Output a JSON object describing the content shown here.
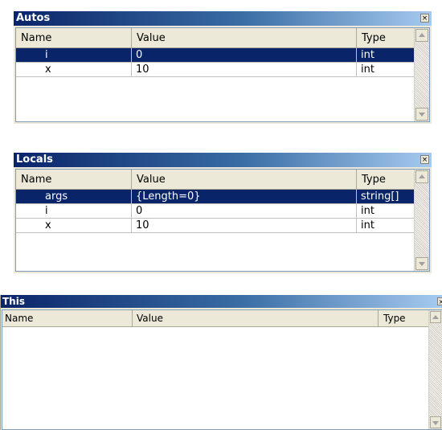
{
  "autos": {
    "title": "Autos",
    "close_glyph": "×",
    "columns": [
      "Name",
      "Value",
      "Type"
    ],
    "rows": [
      {
        "name": "i",
        "value": "0",
        "type": "int",
        "selected": true
      },
      {
        "name": "x",
        "value": "10",
        "type": "int",
        "selected": false
      }
    ]
  },
  "locals": {
    "title": "Locals",
    "close_glyph": "×",
    "columns": [
      "Name",
      "Value",
      "Type"
    ],
    "rows": [
      {
        "name": "args",
        "value": "{Length=0}",
        "type": "string[]",
        "selected": true
      },
      {
        "name": "i",
        "value": "0",
        "type": "int",
        "selected": false
      },
      {
        "name": "x",
        "value": "10",
        "type": "int",
        "selected": false
      }
    ]
  },
  "this": {
    "title": "This",
    "close_glyph": "×",
    "columns": [
      "Name",
      "Value",
      "Type"
    ],
    "rows": []
  },
  "colors": {
    "title_start": "#0a246a",
    "title_end": "#a6caf0",
    "selection": "#0a246a",
    "chrome": "#ece9d8"
  }
}
